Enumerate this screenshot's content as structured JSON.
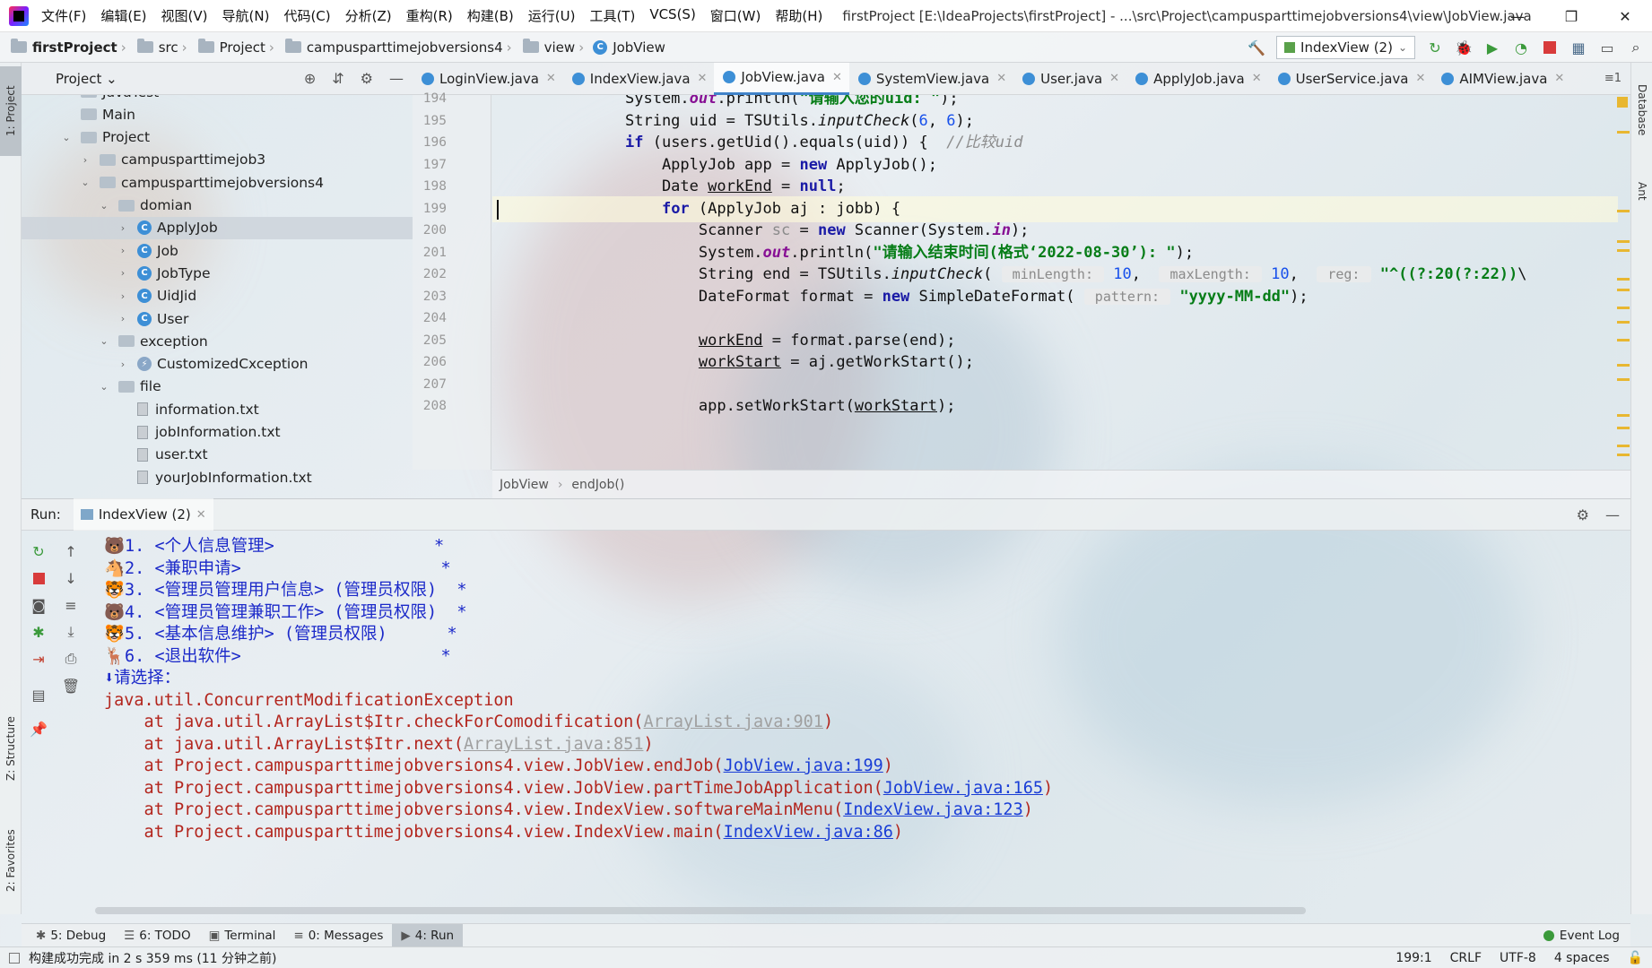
{
  "menu": {
    "items": [
      "文件(F)",
      "编辑(E)",
      "视图(V)",
      "导航(N)",
      "代码(C)",
      "分析(Z)",
      "重构(R)",
      "构建(B)",
      "运行(U)",
      "工具(T)",
      "VCS(S)",
      "窗口(W)",
      "帮助(H)"
    ],
    "title": "firstProject [E:\\IdeaProjects\\firstProject] - ...\\src\\Project\\campusparttimejobversions4\\view\\JobView.java"
  },
  "nav": {
    "crumbs": [
      "firstProject",
      "src",
      "Project",
      "campusparttimejobversions4",
      "view",
      "JobView"
    ],
    "run_config": "IndexView (2)"
  },
  "left_strip": {
    "project": "1: Project",
    "structure": "Z: Structure",
    "favorites": "2: Favorites"
  },
  "right_strip": {
    "database": "Database",
    "ant": "Ant"
  },
  "project_panel": {
    "title": "Project",
    "tree": [
      {
        "label": "JavaTest",
        "indent": 0,
        "kind": "folder",
        "chev": "›"
      },
      {
        "label": "Main",
        "indent": 0,
        "kind": "folder",
        "chev": ""
      },
      {
        "label": "Project",
        "indent": 0,
        "kind": "folder",
        "chev": "⌄"
      },
      {
        "label": "campusparttimejob3",
        "indent": 1,
        "kind": "folder",
        "chev": "›"
      },
      {
        "label": "campusparttimejobversions4",
        "indent": 1,
        "kind": "folder",
        "chev": "⌄"
      },
      {
        "label": "domian",
        "indent": 2,
        "kind": "folder",
        "chev": "⌄"
      },
      {
        "label": "ApplyJob",
        "indent": 3,
        "kind": "class",
        "chev": "›",
        "selected": true
      },
      {
        "label": "Job",
        "indent": 3,
        "kind": "class",
        "chev": "›"
      },
      {
        "label": "JobType",
        "indent": 3,
        "kind": "class",
        "chev": "›"
      },
      {
        "label": "UidJid",
        "indent": 3,
        "kind": "class",
        "chev": "›"
      },
      {
        "label": "User",
        "indent": 3,
        "kind": "class",
        "chev": "›"
      },
      {
        "label": "exception",
        "indent": 2,
        "kind": "folder",
        "chev": "⌄"
      },
      {
        "label": "CustomizedCxception",
        "indent": 3,
        "kind": "exclass",
        "chev": "›"
      },
      {
        "label": "file",
        "indent": 2,
        "kind": "folder",
        "chev": "⌄"
      },
      {
        "label": "information.txt",
        "indent": 3,
        "kind": "txt",
        "chev": ""
      },
      {
        "label": "jobInformation.txt",
        "indent": 3,
        "kind": "txt",
        "chev": ""
      },
      {
        "label": "user.txt",
        "indent": 3,
        "kind": "txt",
        "chev": ""
      },
      {
        "label": "yourJobInformation.txt",
        "indent": 3,
        "kind": "txt",
        "chev": ""
      }
    ]
  },
  "editor": {
    "tabs": [
      {
        "label": "LoginView.java",
        "active": false
      },
      {
        "label": "IndexView.java",
        "active": false
      },
      {
        "label": "JobView.java",
        "active": true
      },
      {
        "label": "SystemView.java",
        "active": false
      },
      {
        "label": "User.java",
        "active": false
      },
      {
        "label": "ApplyJob.java",
        "active": false
      },
      {
        "label": "UserService.java",
        "active": false
      },
      {
        "label": "AIMView.java",
        "active": false
      }
    ],
    "tabs_more": "≡1",
    "line_numbers": [
      "194",
      "195",
      "196",
      "197",
      "198",
      "199",
      "200",
      "201",
      "202",
      "203",
      "204",
      "205",
      "206",
      "207",
      "208"
    ],
    "code_lines": [
      "System.out.println(\"请输入您的uid: \");",
      "String uid = TSUtils.inputCheck(6, 6);",
      "if (users.getUid().equals(uid)) {  //比较uid",
      "    ApplyJob app = new ApplyJob();",
      "    Date workEnd = null;",
      "    for (ApplyJob aj : jobb) {",
      "        Scanner sc = new Scanner(System.in);",
      "        System.out.println(\"请输入结束时间(格式‘2022-08-30’): \");",
      "        String end = TSUtils.inputCheck( minLength: 10,  maxLength: 10,  reg: \"^((?:20(?:22))\\",
      "        DateFormat format = new SimpleDateFormat( pattern: \"yyyy-MM-dd\");",
      "",
      "        workEnd = format.parse(end);",
      "        workStart = aj.getWorkStart();",
      "",
      "        app.setWorkStart(workStart);"
    ],
    "crumb": [
      "JobView",
      "endJob()"
    ]
  },
  "run": {
    "label": "Run:",
    "tab": "IndexView (2)",
    "console": [
      {
        "text": "1. <个人信息管理>                *",
        "cls": "blue",
        "icon": "🐻"
      },
      {
        "text": "2. <兼职申请>                    *",
        "cls": "blue",
        "icon": "🐴"
      },
      {
        "text": "3. <管理员管理用户信息> (管理员权限)  *",
        "cls": "blue",
        "icon": "🐯"
      },
      {
        "text": "4. <管理员管理兼职工作> (管理员权限)  *",
        "cls": "blue",
        "icon": "🐻"
      },
      {
        "text": "5. <基本信息维护> (管理员权限)      *",
        "cls": "blue",
        "icon": "🐯"
      },
      {
        "text": "6. <退出软件>                    *",
        "cls": "blue",
        "icon": "🦌"
      },
      {
        "text": "请选择：",
        "cls": "blue",
        "icon": "⬇"
      },
      {
        "text": "java.util.ConcurrentModificationException",
        "cls": "red"
      },
      {
        "text": "    at java.util.ArrayList$Itr.checkForComodification(",
        "cls": "red",
        "link": "ArrayList.java:901",
        "dim": true,
        "tail": ")"
      },
      {
        "text": "    at java.util.ArrayList$Itr.next(",
        "cls": "red",
        "link": "ArrayList.java:851",
        "dim": true,
        "tail": ")"
      },
      {
        "text": "    at Project.campusparttimejobversions4.view.JobView.endJob(",
        "cls": "red",
        "link": "JobView.java:199",
        "tail": ")"
      },
      {
        "text": "    at Project.campusparttimejobversions4.view.JobView.partTimeJobApplication(",
        "cls": "red",
        "link": "JobView.java:165",
        "tail": ")"
      },
      {
        "text": "    at Project.campusparttimejobversions4.view.IndexView.softwareMainMenu(",
        "cls": "red",
        "link": "IndexView.java:123",
        "tail": ")"
      },
      {
        "text": "    at Project.campusparttimejobversions4.view.IndexView.main(",
        "cls": "red",
        "link": "IndexView.java:86",
        "tail": ")"
      }
    ]
  },
  "tool_tabs": [
    {
      "label": "5: Debug",
      "icon": "bug-icon",
      "active": false
    },
    {
      "label": "6: TODO",
      "icon": "list-icon",
      "active": false
    },
    {
      "label": "Terminal",
      "icon": "terminal-icon",
      "active": false
    },
    {
      "label": "0: Messages",
      "icon": "messages-icon",
      "active": false
    },
    {
      "label": "4: Run",
      "icon": "run-icon",
      "active": true
    }
  ],
  "event_log": "Event Log",
  "status": {
    "message": "构建成功完成 in 2 s 359 ms (11 分钟之前)",
    "position": "199:1",
    "line_sep": "CRLF",
    "encoding": "UTF-8",
    "indent": "4 spaces"
  },
  "colors": {
    "accent": "#4083c9",
    "keyword": "#1a1aa6",
    "string": "#067d17",
    "console_blue": "#1b29c9",
    "console_red": "#b3261e"
  }
}
